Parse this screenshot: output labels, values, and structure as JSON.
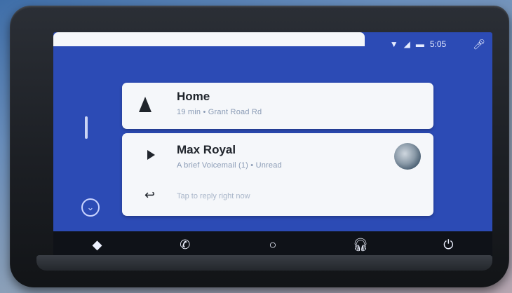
{
  "status_bar": {
    "time": "5:05",
    "icons": [
      "wifi-icon",
      "signal-icon",
      "battery-icon"
    ],
    "mic_icon": "microphone-icon"
  },
  "cards": {
    "navigation": {
      "title": "Home",
      "subtitle": "19 min • Grant Road Rd",
      "icon": "navigation-arrow-icon"
    },
    "message": {
      "title": "Max Royal",
      "subtitle": "A brief Voicemail (1) • Unread",
      "icon": "play-icon",
      "reply_icon": "reply-icon",
      "reply_hint": "Tap to reply right now"
    }
  },
  "side_nav": {
    "indicator": "page-indicator",
    "expand_icon": "chevron-down-icon"
  },
  "bottom_nav": [
    "navigation-icon",
    "phone-icon",
    "home-icon",
    "headphones-icon",
    "power-icon"
  ],
  "colors": {
    "screen_bg": "#2c4bb5",
    "card_bg": "#f5f7fa",
    "nav_bg": "#0f1218"
  }
}
